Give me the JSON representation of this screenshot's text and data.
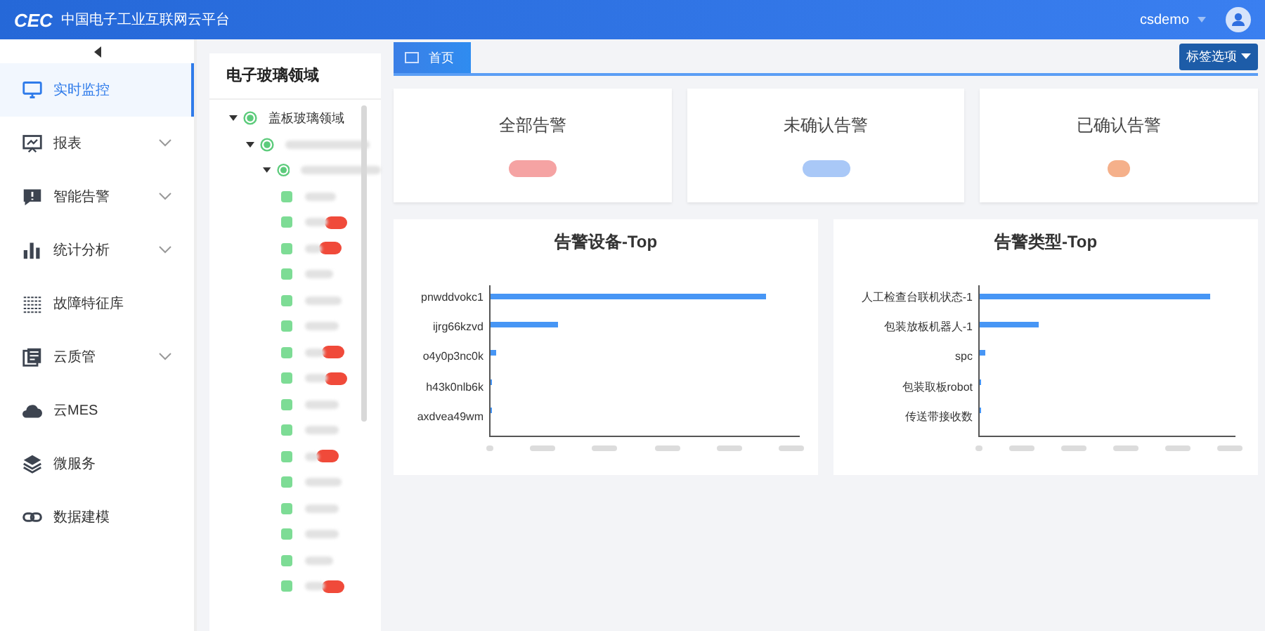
{
  "header": {
    "logo": "CEC",
    "title": "中国电子工业互联网云平台",
    "user": "csdemo"
  },
  "sidebar": {
    "items": [
      {
        "label": "实时监控",
        "selected": true,
        "expandable": false
      },
      {
        "label": "报表",
        "selected": false,
        "expandable": true
      },
      {
        "label": "智能告警",
        "selected": false,
        "expandable": true
      },
      {
        "label": "统计分析",
        "selected": false,
        "expandable": true
      },
      {
        "label": "故障特征库",
        "selected": false,
        "expandable": false
      },
      {
        "label": "云质管",
        "selected": false,
        "expandable": true
      },
      {
        "label": "云MES",
        "selected": false,
        "expandable": false
      },
      {
        "label": "微服务",
        "selected": false,
        "expandable": false
      },
      {
        "label": "数据建模",
        "selected": false,
        "expandable": false
      }
    ]
  },
  "tree": {
    "title": "电子玻璃领域",
    "nodes": [
      {
        "label": "盖板玻璃领域",
        "expanded": true,
        "children": [
          {
            "kind": "redacted",
            "expanded": true,
            "children": [
              {
                "kind": "redacted",
                "expanded": true,
                "children": [
                  {
                    "kind": "redacted",
                    "alert": false
                  },
                  {
                    "kind": "redacted",
                    "alert": true
                  },
                  {
                    "kind": "redacted",
                    "alert": true
                  },
                  {
                    "kind": "redacted",
                    "alert": false
                  },
                  {
                    "kind": "redacted",
                    "alert": false
                  },
                  {
                    "kind": "redacted",
                    "alert": false
                  },
                  {
                    "kind": "redacted",
                    "alert": true
                  },
                  {
                    "kind": "redacted",
                    "alert": true
                  },
                  {
                    "kind": "redacted",
                    "alert": false
                  },
                  {
                    "kind": "redacted",
                    "alert": false
                  },
                  {
                    "kind": "redacted",
                    "alert": true
                  },
                  {
                    "kind": "redacted",
                    "alert": false
                  },
                  {
                    "kind": "redacted",
                    "alert": false
                  },
                  {
                    "kind": "redacted",
                    "alert": false
                  },
                  {
                    "kind": "redacted",
                    "alert": false
                  },
                  {
                    "kind": "redacted",
                    "alert": true
                  }
                ]
              }
            ]
          }
        ]
      }
    ]
  },
  "tabs": [
    {
      "label": "首页",
      "selected": true
    }
  ],
  "tab_options": "标签选项",
  "cards": [
    {
      "title": "全部告警",
      "color": "#f5a3a3"
    },
    {
      "title": "未确认告警",
      "color": "#a9c8f7"
    },
    {
      "title": "已确认告警",
      "color": "#f5b08a"
    }
  ],
  "charts": [
    {
      "title": "告警设备-Top",
      "bars": [
        {
          "label": "pnwddvokc1",
          "level": 0.89
        },
        {
          "label": "ijrg66kzvd",
          "level": 0.22
        },
        {
          "label": "o4y0p3nc0k",
          "level": 0.02
        },
        {
          "label": "h43k0nlb6k",
          "level": 0.006
        },
        {
          "label": "axdvea49wm",
          "level": 0.003
        }
      ]
    },
    {
      "title": "告警类型-Top",
      "bars": [
        {
          "label": "人工检查台联机状态-1",
          "level": 0.9
        },
        {
          "label": "包装放板机器人-1",
          "level": 0.23
        },
        {
          "label": "spc",
          "level": 0.02
        },
        {
          "label": "包装取板robot",
          "level": 0.006
        },
        {
          "label": "传送带接收数",
          "level": 0.004
        }
      ]
    }
  ]
}
